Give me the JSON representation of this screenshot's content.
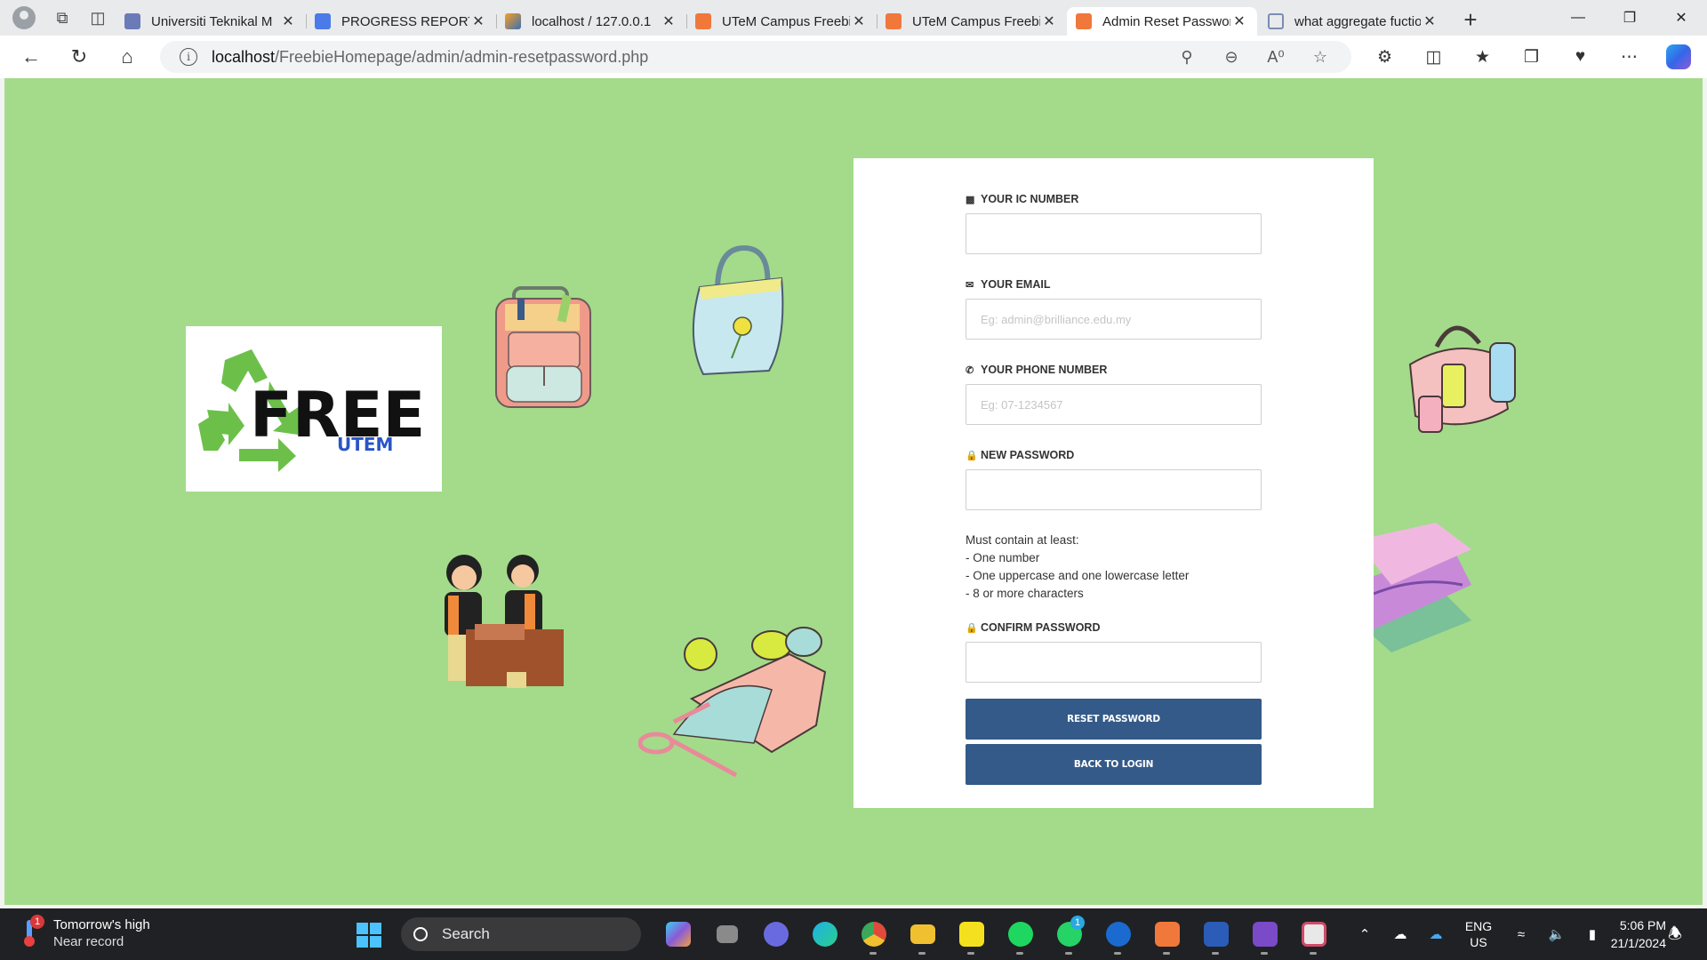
{
  "browser": {
    "tabs": [
      {
        "title": "Universiti Teknikal M",
        "favicon": "university-icon"
      },
      {
        "title": "PROGRESS REPORT",
        "favicon": "document-icon"
      },
      {
        "title": "localhost / 127.0.0.1",
        "favicon": "phpmyadmin-icon"
      },
      {
        "title": "UTeM Campus Freebie",
        "favicon": "xampp-icon"
      },
      {
        "title": "UTeM Campus Freebie",
        "favicon": "xampp-icon"
      },
      {
        "title": "Admin Reset Password",
        "favicon": "xampp-icon",
        "active": true
      },
      {
        "title": "what aggregate fuction",
        "favicon": "search-icon"
      }
    ],
    "address": {
      "host": "localhost",
      "path": "/FreebieHomepage/admin/admin-resetpassword.php"
    }
  },
  "page": {
    "background_color": "#a3db8a",
    "logo": {
      "word": "FREE",
      "sub": "UTEM"
    },
    "form": {
      "ic_label": "YOUR IC NUMBER",
      "ic_value": "",
      "email_label": "YOUR EMAIL",
      "email_placeholder": "Eg: admin@brilliance.edu.my",
      "phone_label": "YOUR PHONE NUMBER",
      "phone_placeholder": "Eg: 07-1234567",
      "new_password_label": "NEW PASSWORD",
      "hint_lines": [
        "Must contain at least:",
        "- One number",
        "- One uppercase and one lowercase letter",
        "- 8 or more characters"
      ],
      "confirm_password_label": "CONFIRM PASSWORD",
      "reset_button": "RESET PASSWORD",
      "back_button": "BACK TO LOGIN",
      "button_color": "#335a88"
    }
  },
  "taskbar": {
    "weather": {
      "line1": "Tomorrow's high",
      "line2": "Near record",
      "badge": "1"
    },
    "search_label": "Search",
    "whatsapp_badge": "1",
    "language": {
      "line1": "ENG",
      "line2": "US"
    },
    "clock": {
      "time": "5:06 PM",
      "date": "21/1/2024"
    }
  }
}
